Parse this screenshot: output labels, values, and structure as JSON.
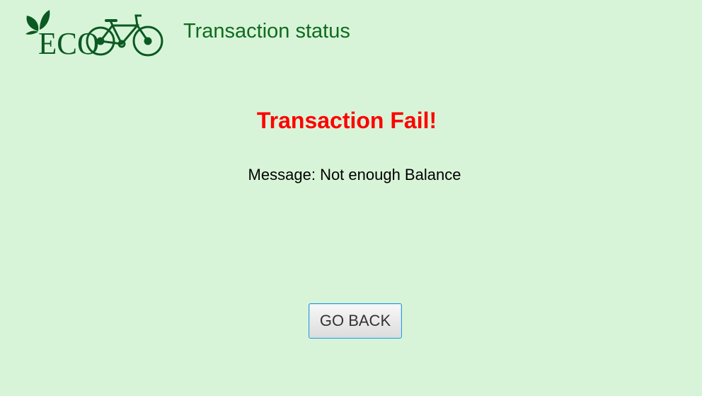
{
  "header": {
    "logo_text": "ECO",
    "title": "Transaction status"
  },
  "main": {
    "status_heading": "Transaction Fail!",
    "message_label": "Message:",
    "message_text": "Not enough Balance",
    "go_back_label": "GO BACK"
  },
  "colors": {
    "background": "#d8f4d8",
    "brand_green": "#0f6b1e",
    "logo_green": "#0b5a22",
    "error_red": "#ff0000",
    "button_border": "#2d9ad4"
  }
}
